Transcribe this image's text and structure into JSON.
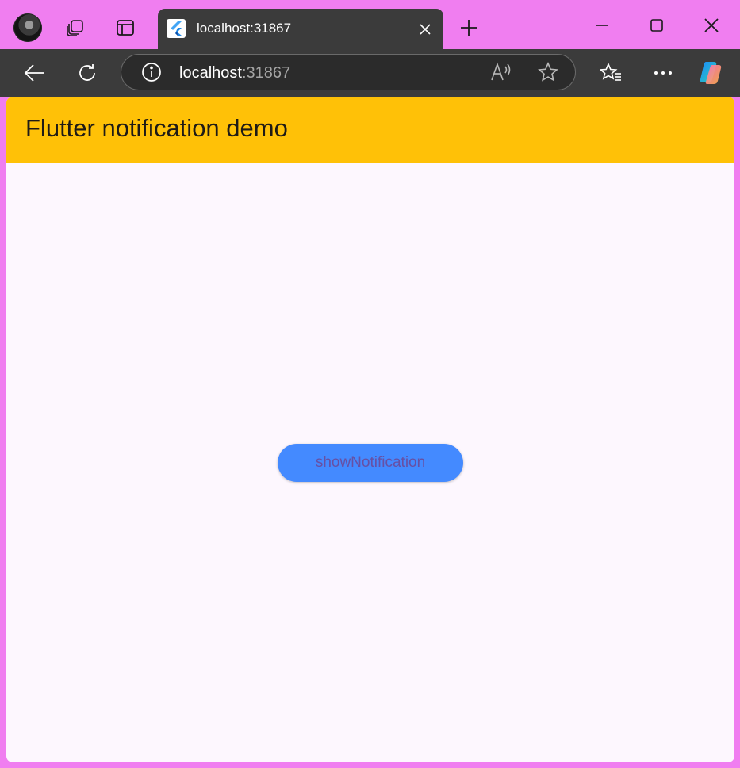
{
  "browser": {
    "tab": {
      "title": "localhost:31867",
      "favicon": "flutter-icon"
    },
    "address": {
      "host": "localhost",
      "port": ":31867"
    },
    "icons": {
      "workspaces": "workspaces-icon",
      "tab_actions": "tab-actions-icon",
      "new_tab": "plus-icon",
      "minimize": "minimize-icon",
      "maximize": "maximize-icon",
      "close": "close-icon",
      "back": "back-arrow-icon",
      "refresh": "refresh-icon",
      "site_info": "info-icon",
      "read_aloud": "read-aloud-icon",
      "favorite": "star-icon",
      "favorites_list": "favorites-icon",
      "more": "more-icon",
      "copilot": "copilot-icon"
    },
    "colors": {
      "frame": "#f07ef0",
      "toolbar": "#3b3b3b"
    }
  },
  "app": {
    "appbar_title": "Flutter notification demo",
    "button_label": "showNotification",
    "colors": {
      "appbar": "#ffc107",
      "background": "#fdf7fe",
      "button": "#448aff",
      "button_text": "#6750a4"
    }
  }
}
